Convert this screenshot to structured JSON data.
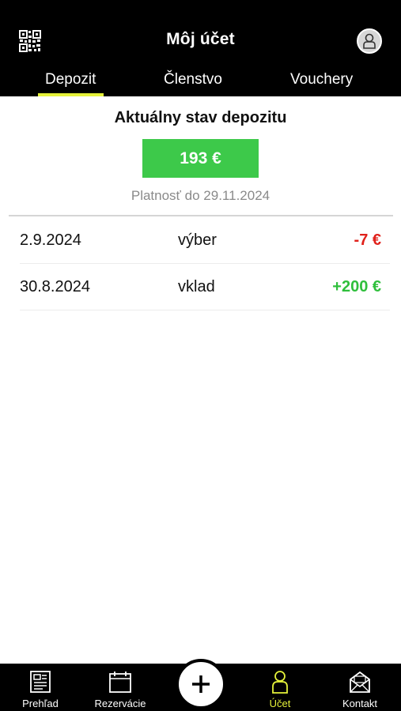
{
  "header": {
    "title": "Môj účet",
    "qr_icon": "qr-code-icon",
    "profile_icon": "user-icon"
  },
  "tabs": [
    {
      "label": "Depozit",
      "active": true
    },
    {
      "label": "Členstvo",
      "active": false
    },
    {
      "label": "Vouchery",
      "active": false
    }
  ],
  "deposit": {
    "title": "Aktuálny stav depozitu",
    "balance": "193 €",
    "validity": "Platnosť do 29.11.2024"
  },
  "transactions": [
    {
      "date": "2.9.2024",
      "type": "výber",
      "amount": "-7 €",
      "direction": "negative"
    },
    {
      "date": "30.8.2024",
      "type": "vklad",
      "amount": "+200 €",
      "direction": "positive"
    }
  ],
  "bottom_nav": {
    "items": [
      {
        "label": "Prehľad",
        "icon": "document-icon"
      },
      {
        "label": "Rezervácie",
        "icon": "calendar-icon"
      },
      {
        "label": "Účet",
        "icon": "user-icon",
        "active": true
      },
      {
        "label": "Kontakt",
        "icon": "envelope-icon"
      }
    ],
    "add_icon": "plus-icon"
  },
  "colors": {
    "header_bg": "#000000",
    "accent_yellow": "#e5f23a",
    "balance_green": "#3dc94a",
    "negative": "#e0211b",
    "positive": "#2fbf3c"
  }
}
